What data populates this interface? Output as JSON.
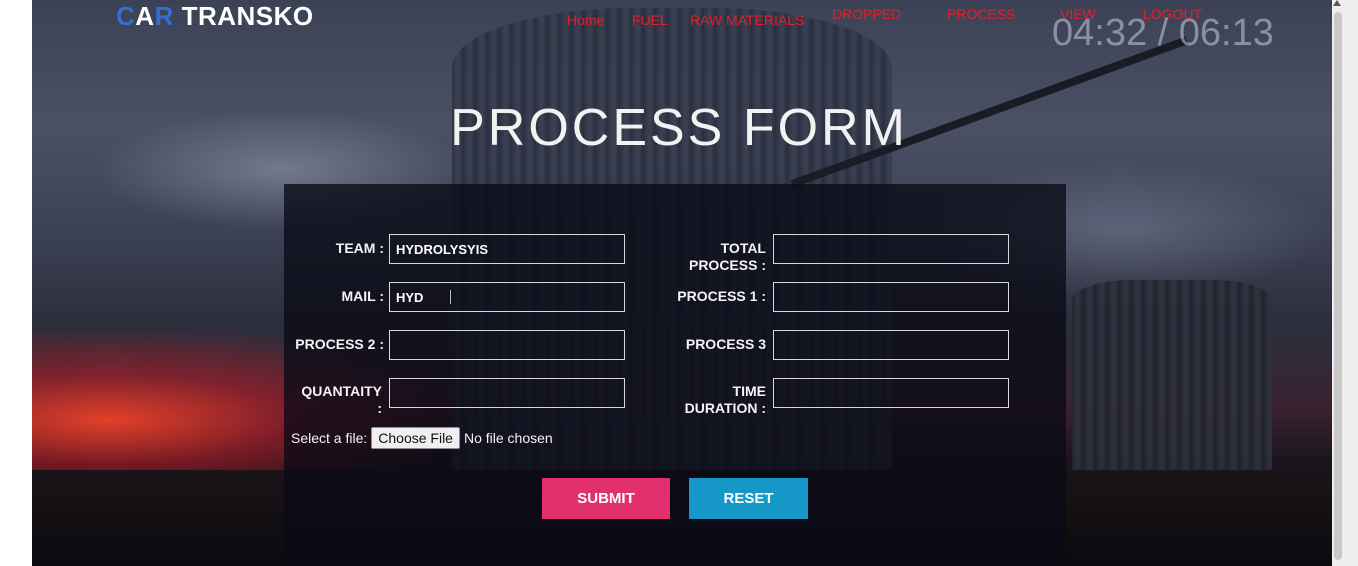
{
  "brand": {
    "logo_part1": "C",
    "logo_icon": "A",
    "logo_part2": "R",
    "logo_rest": " TRANSKO",
    "accent": "#2f6fd6"
  },
  "nav": {
    "color": "#e0202c",
    "items": [
      "Home",
      "FUEL",
      "RAW MATERIALS",
      "DROPPED",
      "PROCESS",
      "VIEW",
      "LOGOUT"
    ]
  },
  "clock": "04:32 / 06:13",
  "title": "PROCESS FORM",
  "form": {
    "team": {
      "label": "TEAM :",
      "value": "HYDROLYSYIS"
    },
    "mail": {
      "label": "MAIL :",
      "value": "HYD"
    },
    "process2": {
      "label": "PROCESS 2 :",
      "value": ""
    },
    "quantity": {
      "label": "QUANTAITY :",
      "value": ""
    },
    "total_process": {
      "label": "TOTAL PROCESS :",
      "value": ""
    },
    "process1": {
      "label": "PROCESS 1 :",
      "value": ""
    },
    "process3": {
      "label": "PROCESS 3",
      "value": ""
    },
    "time_duration": {
      "label": "TIME DURATION :",
      "value": ""
    },
    "file": {
      "label": "Select a file:",
      "button": "Choose File",
      "status": "No file chosen"
    }
  },
  "buttons": {
    "submit": {
      "label": "SUBMIT",
      "color": "#e0316e"
    },
    "reset": {
      "label": "RESET",
      "color": "#1597c8"
    }
  }
}
